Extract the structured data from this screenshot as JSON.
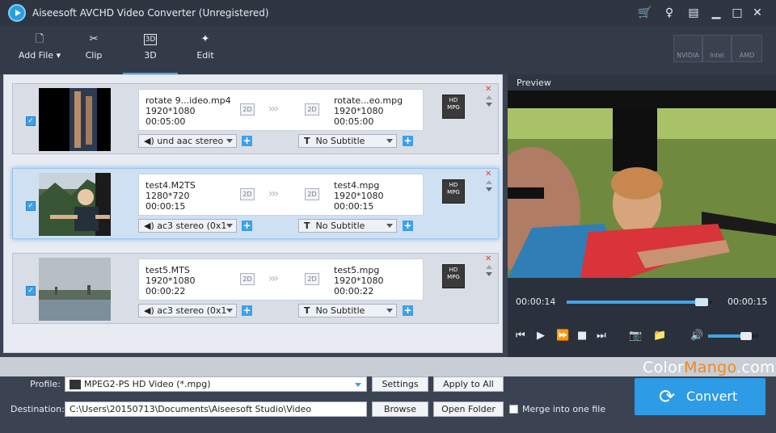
{
  "app": {
    "title": "Aiseesoft AVCHD Video Converter (Unregistered)"
  },
  "toolbar": {
    "add_file": "Add File",
    "clip": "Clip",
    "threed": "3D",
    "edit": "Edit",
    "hw": [
      "NVIDIA",
      "Intel",
      "AMD"
    ]
  },
  "items": [
    {
      "src_name": "rotate 9...ideo.mp4",
      "src_res": "1920*1080",
      "src_dur": "00:05:00",
      "dst_name": "rotate...eo.mpg",
      "dst_res": "1920*1080",
      "dst_dur": "00:05:00",
      "audio": "und aac stereo",
      "subtitle": "No Subtitle",
      "badge": "2D"
    },
    {
      "src_name": "test4.M2TS",
      "src_res": "1280*720",
      "src_dur": "00:00:15",
      "dst_name": "test4.mpg",
      "dst_res": "1920*1080",
      "dst_dur": "00:00:15",
      "audio": "ac3 stereo (0x1",
      "subtitle": "No Subtitle",
      "badge": "2D"
    },
    {
      "src_name": "test5.MTS",
      "src_res": "1920*1080",
      "src_dur": "00:00:22",
      "dst_name": "test5.mpg",
      "dst_res": "1920*1080",
      "dst_dur": "00:00:22",
      "audio": "ac3 stereo (0x1",
      "subtitle": "No Subtitle",
      "badge": "2D"
    }
  ],
  "preview": {
    "label": "Preview",
    "time_current": "00:00:14",
    "time_total": "00:00:15",
    "progress": 0.93,
    "volume": 0.75
  },
  "bottom": {
    "profile_label": "Profile:",
    "profile_value": "MPEG2-PS HD Video (*.mpg)",
    "settings": "Settings",
    "apply_all": "Apply to All",
    "dest_label": "Destination:",
    "dest_value": "C:\\Users\\20150713\\Documents\\Aiseesoft Studio\\Video",
    "browse": "Browse",
    "open_folder": "Open Folder",
    "merge": "Merge into one file",
    "convert": "Convert"
  },
  "watermark": {
    "a": "Color",
    "b": "Mango",
    "c": ".com"
  },
  "icons": {
    "subtitle": "T",
    "mpg_line1": "HD",
    "mpg_line2": "MPG"
  },
  "colors": {
    "accent": "#2d9be6",
    "watermark_orange": "#f08a1c"
  }
}
